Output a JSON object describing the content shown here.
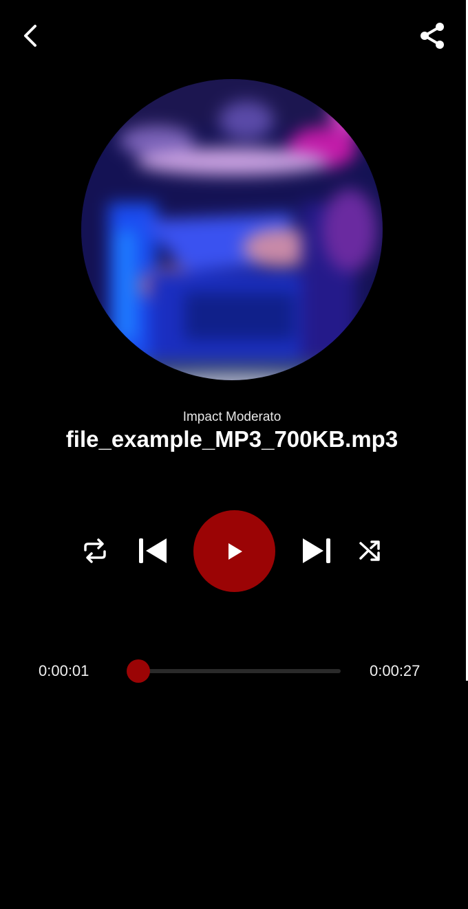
{
  "header": {
    "back_icon": "chevron-left-icon",
    "share_icon": "share-icon"
  },
  "track": {
    "artist": "Impact Moderato",
    "title": "file_example_MP3_700KB.mp3"
  },
  "controls": {
    "repeat_icon": "repeat-icon",
    "previous_icon": "skip-previous-icon",
    "play_icon": "play-icon",
    "next_icon": "skip-next-icon",
    "shuffle_icon": "shuffle-icon"
  },
  "progress": {
    "elapsed": "0:00:01",
    "total": "0:00:27",
    "fraction": 0.037
  },
  "colors": {
    "background": "#000000",
    "accent": "#9b0405",
    "text": "#ffffff",
    "track": "#2a2a2a"
  }
}
